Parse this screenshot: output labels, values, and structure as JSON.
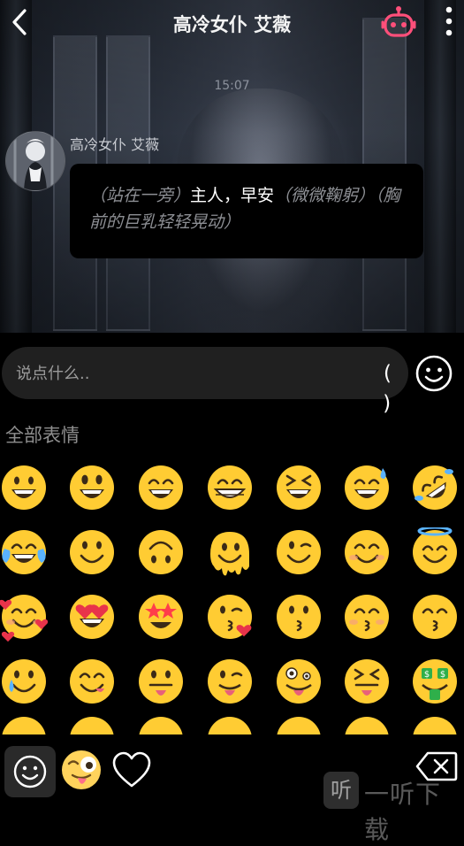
{
  "header": {
    "title": "高冷女仆 艾薇",
    "back_icon": "chevron-left-icon",
    "robot_icon": "robot-icon",
    "more_icon": "more-vertical-icon",
    "robot_color": "#ff4f7a"
  },
  "chat": {
    "timestamp": "15:07",
    "messages": [
      {
        "sender": "高冷女仆 艾薇",
        "action_1": "（站在一旁）",
        "speech": "主人，早安",
        "action_2": "（微微鞠躬）（胸前的巨乳轻轻晃动）"
      }
    ]
  },
  "input": {
    "placeholder": "说点什么..",
    "paren_label": "( )",
    "emoji_toggle_icon": "smiley-icon"
  },
  "emoji_panel": {
    "section_label": "全部表情",
    "emojis": [
      {
        "name": "grinning-face",
        "type": "grin"
      },
      {
        "name": "grinning-face-big-eyes",
        "type": "grin-big"
      },
      {
        "name": "grinning-face-smiling-eyes",
        "type": "grin-squint"
      },
      {
        "name": "beaming-face",
        "type": "beam"
      },
      {
        "name": "grinning-squinting-face",
        "type": "laugh-xd"
      },
      {
        "name": "grinning-face-sweat",
        "type": "sweat"
      },
      {
        "name": "rolling-on-floor-laughing",
        "type": "rofl"
      },
      {
        "name": "face-with-tears-of-joy",
        "type": "joy"
      },
      {
        "name": "slightly-smiling-face",
        "type": "slight"
      },
      {
        "name": "upside-down-face",
        "type": "upside"
      },
      {
        "name": "melting-face",
        "type": "melt"
      },
      {
        "name": "winking-face",
        "type": "wink"
      },
      {
        "name": "smiling-face-smiling-eyes",
        "type": "blush"
      },
      {
        "name": "smiling-face-halo",
        "type": "halo"
      },
      {
        "name": "smiling-face-hearts",
        "type": "hearts"
      },
      {
        "name": "heart-eyes",
        "type": "heart-eyes"
      },
      {
        "name": "star-struck",
        "type": "star"
      },
      {
        "name": "face-blowing-kiss",
        "type": "kiss-heart"
      },
      {
        "name": "kissing-face",
        "type": "kiss"
      },
      {
        "name": "kissing-face-closed-eyes",
        "type": "kiss-closed"
      },
      {
        "name": "kissing-face-smiling-eyes",
        "type": "kiss-smile"
      },
      {
        "name": "smiling-face-tear",
        "type": "tear"
      },
      {
        "name": "face-savoring-food",
        "type": "yum"
      },
      {
        "name": "face-with-tongue",
        "type": "tongue"
      },
      {
        "name": "winking-face-tongue",
        "type": "wink-tongue"
      },
      {
        "name": "zany-face",
        "type": "zany"
      },
      {
        "name": "squinting-face-tongue",
        "type": "squint-tongue"
      },
      {
        "name": "money-mouth-face",
        "type": "money"
      }
    ]
  },
  "bottom_bar": {
    "tabs": [
      {
        "name": "tab-emoji",
        "icon": "smiley-icon",
        "active": true
      },
      {
        "name": "tab-sticker",
        "icon": "sticker-face-icon",
        "active": false
      },
      {
        "name": "tab-favorites",
        "icon": "heart-icon",
        "active": false
      }
    ],
    "delete_icon": "backspace-icon",
    "watermark_glyph": "听",
    "watermark_text": "一听下载"
  },
  "colors": {
    "emoji_yellow": "#ffcc33",
    "input_bg": "#202020",
    "label_gray": "#8e8e8e"
  }
}
